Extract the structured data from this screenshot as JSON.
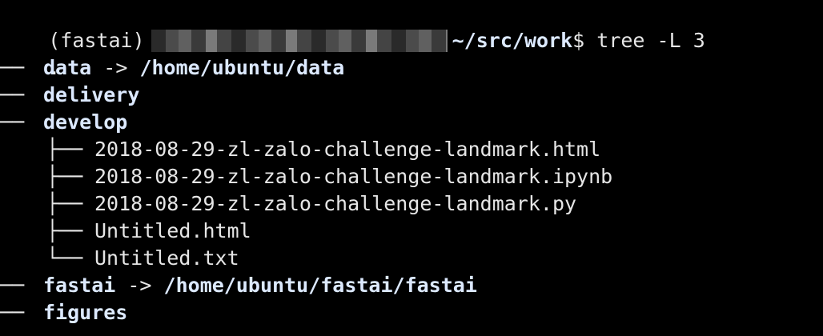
{
  "prompt": {
    "env": "(fastai)",
    "path": "~/src/work",
    "symbol": "$",
    "command": "tree -L 3"
  },
  "tree": {
    "root": ".",
    "branch_mid": "├──",
    "branch_last": "└──",
    "branch_top": "──",
    "vline": "│",
    "arrow": "->",
    "entries": [
      {
        "name": "data",
        "target": "/home/ubuntu/data"
      },
      {
        "name": "delivery"
      },
      {
        "name": "develop"
      },
      {
        "name": "2018-08-29-zl-zalo-challenge-landmark.html"
      },
      {
        "name": "2018-08-29-zl-zalo-challenge-landmark.ipynb"
      },
      {
        "name": "2018-08-29-zl-zalo-challenge-landmark.py"
      },
      {
        "name": "Untitled.html"
      },
      {
        "name": "Untitled.txt"
      },
      {
        "name": "fastai",
        "target": "/home/ubuntu/fastai/fastai"
      },
      {
        "name": "figures"
      }
    ]
  }
}
